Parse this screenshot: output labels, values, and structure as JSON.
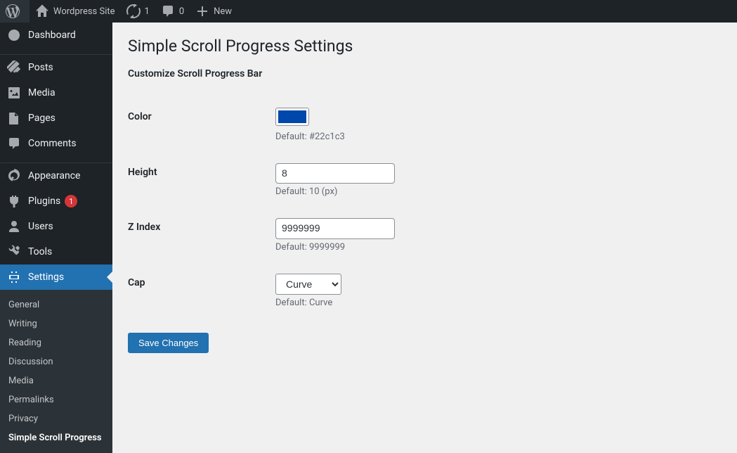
{
  "adminbar": {
    "site_name": "Wordpress Site",
    "updates_count": "1",
    "comments_count": "0",
    "new_label": "New"
  },
  "sidebar": {
    "items": [
      {
        "label": "Dashboard"
      },
      {
        "label": "Posts"
      },
      {
        "label": "Media"
      },
      {
        "label": "Pages"
      },
      {
        "label": "Comments"
      },
      {
        "label": "Appearance"
      },
      {
        "label": "Plugins",
        "badge": "1"
      },
      {
        "label": "Users"
      },
      {
        "label": "Tools"
      },
      {
        "label": "Settings"
      }
    ],
    "submenu": [
      {
        "label": "General"
      },
      {
        "label": "Writing"
      },
      {
        "label": "Reading"
      },
      {
        "label": "Discussion"
      },
      {
        "label": "Media"
      },
      {
        "label": "Permalinks"
      },
      {
        "label": "Privacy"
      },
      {
        "label": "Simple Scroll Progress"
      }
    ]
  },
  "page": {
    "title": "Simple Scroll Progress Settings",
    "subtitle": "Customize Scroll Progress Bar",
    "fields": {
      "color": {
        "label": "Color",
        "value": "#0047ab",
        "help": "Default: #22c1c3"
      },
      "height": {
        "label": "Height",
        "value": "8",
        "help": "Default: 10 (px)"
      },
      "zindex": {
        "label": "Z Index",
        "value": "9999999",
        "help": "Default: 9999999"
      },
      "cap": {
        "label": "Cap",
        "value": "Curve",
        "help": "Default: Curve"
      }
    },
    "submit_label": "Save Changes"
  }
}
